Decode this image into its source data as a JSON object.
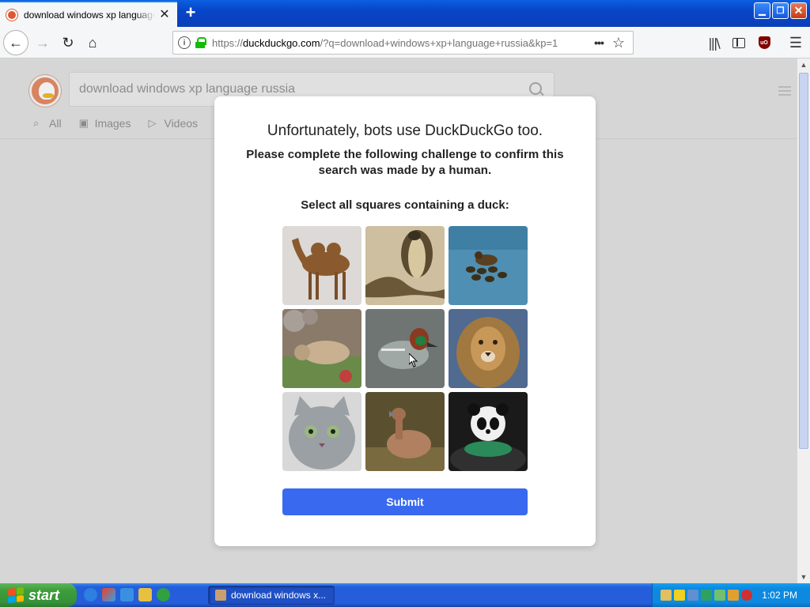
{
  "browser": {
    "tab_title": "download windows xp language russia at DuckDuckGo",
    "url_prefix": "https://",
    "url_host": "duckduckgo.com",
    "url_rest": "/?q=download+windows+xp+language+russia&kp=1"
  },
  "page": {
    "search_query": "download windows xp language russia",
    "tabs": [
      {
        "label": "All",
        "icon": "search-icon"
      },
      {
        "label": "Images",
        "icon": "image-icon"
      },
      {
        "label": "Videos",
        "icon": "video-icon"
      }
    ]
  },
  "challenge": {
    "title": "Unfortunately, bots use DuckDuckGo too.",
    "subtitle": "Please complete the following challenge to confirm this search was made by a human.",
    "prompt": "Select all squares containing a duck:",
    "tiles": [
      "camel",
      "cobra",
      "ducklings",
      "bear",
      "teal-duck",
      "lion",
      "cat",
      "duck",
      "panda"
    ],
    "submit_label": "Submit",
    "accent": "#3969ef"
  },
  "taskbar": {
    "start_label": "start",
    "task_label": "download windows x...",
    "clock": "1:02 PM"
  }
}
